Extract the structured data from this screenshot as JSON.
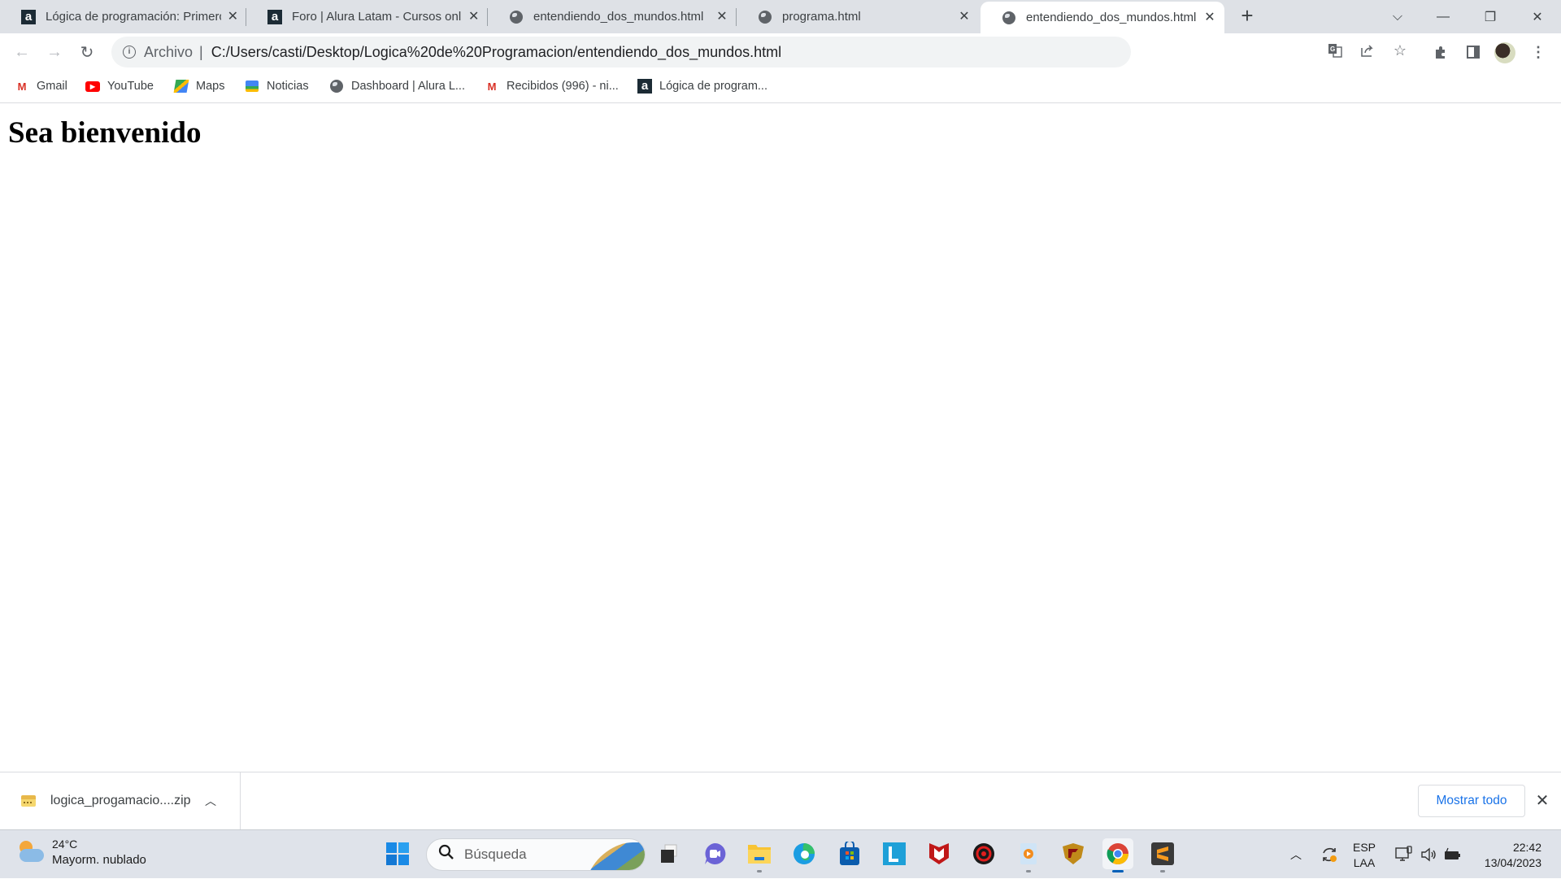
{
  "browser": {
    "tabs": [
      {
        "title": "Lógica de programación: Primeros pasos",
        "favicon": "alura-icon",
        "active": false
      },
      {
        "title": "Foro | Alura Latam - Cursos online",
        "favicon": "alura-icon",
        "active": false
      },
      {
        "title": "entendiendo_dos_mundos.html",
        "favicon": "globe-icon",
        "active": false
      },
      {
        "title": "programa.html",
        "favicon": "globe-icon",
        "active": false
      },
      {
        "title": "entendiendo_dos_mundos.html",
        "favicon": "globe-icon",
        "active": true
      }
    ],
    "new_tab_symbol": "+",
    "window_controls": {
      "tab_search": "⌵",
      "minimize": "—",
      "restore": "❐",
      "close": "✕"
    },
    "toolbar": {
      "back": "←",
      "forward": "→",
      "reload": "↻",
      "site_info_symbol": "i",
      "scheme_label": "Archivo",
      "url": "C:/Users/casti/Desktop/Logica%20de%20Programacion/entendiendo_dos_mundos.html"
    },
    "bookmarks": [
      {
        "label": "Gmail",
        "icon": "gmail-icon"
      },
      {
        "label": "YouTube",
        "icon": "youtube-icon"
      },
      {
        "label": "Maps",
        "icon": "maps-icon"
      },
      {
        "label": "Noticias",
        "icon": "news-icon"
      },
      {
        "label": "Dashboard | Alura L...",
        "icon": "globe-icon"
      },
      {
        "label": "Recibidos (996) - ni...",
        "icon": "gmail-icon"
      },
      {
        "label": "Lógica de program...",
        "icon": "alura-icon"
      }
    ]
  },
  "page": {
    "heading": "Sea bienvenido"
  },
  "downloads": {
    "file_name": "logica_progamacio....zip",
    "show_all_label": "Mostrar todo"
  },
  "taskbar": {
    "weather": {
      "temperature": "24°C",
      "description": "Mayorm. nublado"
    },
    "search_placeholder": "Búsqueda",
    "apps": [
      "start",
      "task-view",
      "teams-chat",
      "file-explorer",
      "edge",
      "microsoft-store",
      "l-app",
      "mcafee",
      "driver-booster",
      "media-player",
      "game-app",
      "chrome",
      "sublime-text"
    ],
    "active_app": "chrome",
    "language": {
      "top": "ESP",
      "bottom": "LAA"
    },
    "clock": {
      "time": "22:42",
      "date": "13/04/2023"
    }
  },
  "colors": {
    "tabstrip_bg": "#dee1e6",
    "link_blue": "#1a73e8",
    "taskbar_bg": "#dfe3ea"
  }
}
